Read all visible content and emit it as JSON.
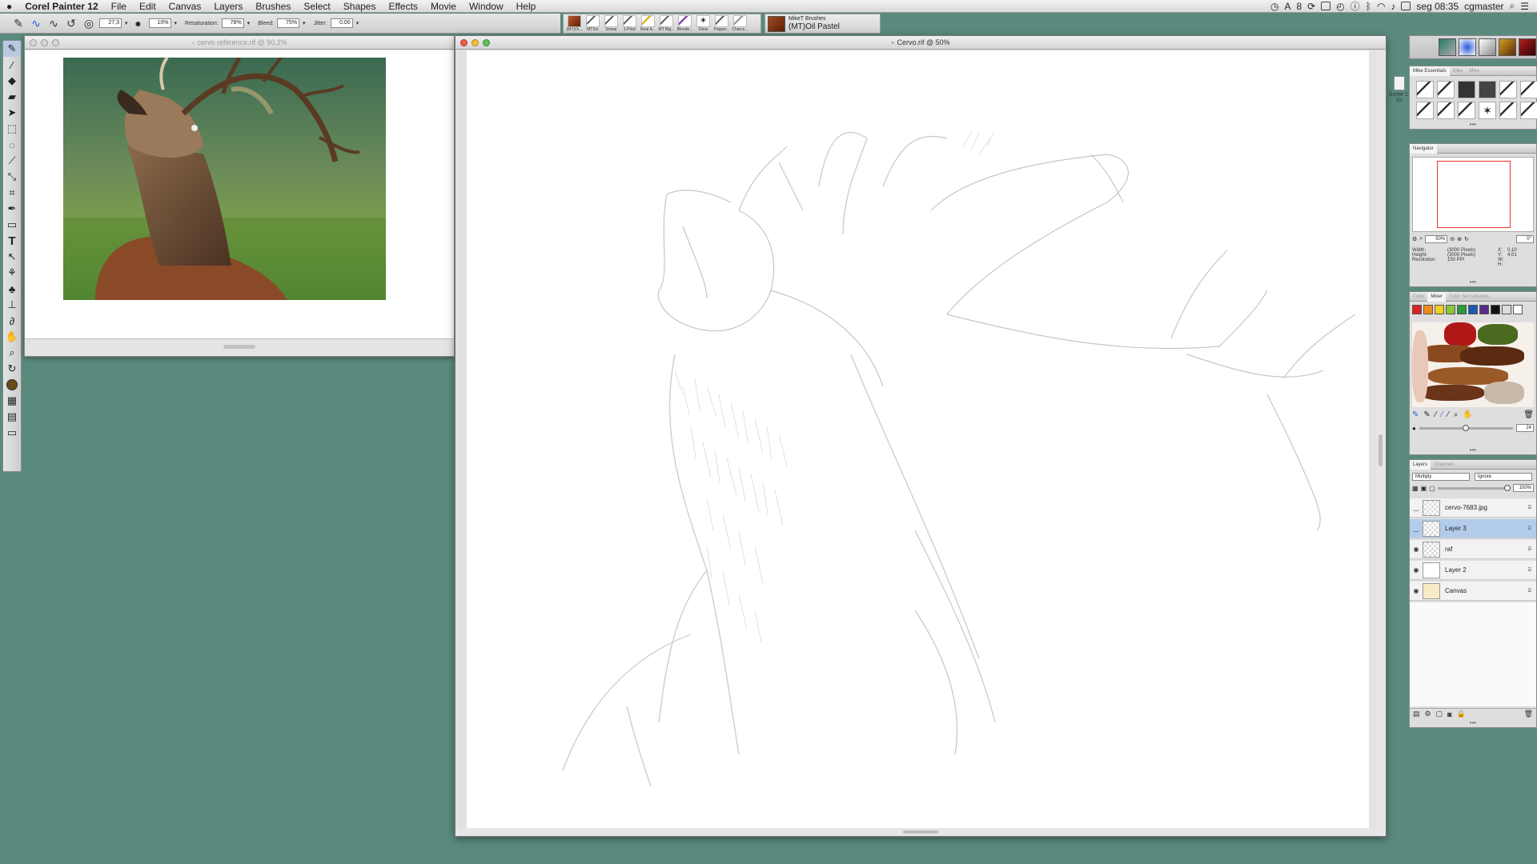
{
  "menubar": {
    "apple": "",
    "app_name": "Corel Painter 12",
    "items": [
      "File",
      "Edit",
      "Canvas",
      "Layers",
      "Brushes",
      "Select",
      "Shapes",
      "Effects",
      "Movie",
      "Window",
      "Help"
    ],
    "status_8": "8",
    "clock": "seg 08:35",
    "user": "cgmaster"
  },
  "property_bar": {
    "size_value": "27,3",
    "opacity_value": "10%",
    "resaturation_label": "Resaturation:",
    "resaturation_value": "78%",
    "bleed_label": "Bleed:",
    "bleed_value": "75%",
    "jitter_label": "Jitter:",
    "jitter_value": "0.00"
  },
  "brush_strip": [
    {
      "label": "(MT)Oi..."
    },
    {
      "label": "MTScr"
    },
    {
      "label": "Smear"
    },
    {
      "label": "1-Pixel"
    },
    {
      "label": "Real A..."
    },
    {
      "label": "MT Big..."
    },
    {
      "label": "Blende..."
    },
    {
      "label": "Glow"
    },
    {
      "label": "Pepper..."
    },
    {
      "label": "Charco..."
    }
  ],
  "current_brush": {
    "category": "MikeT Brushes",
    "variant": "(MT)Oil Pastel"
  },
  "ref_window": {
    "title": "cervo reference.rif @ 90,2%"
  },
  "main_window": {
    "title": "Cervo.rif @ 50%"
  },
  "screen_label": "Scree 1-10-",
  "brush_panel": {
    "tabs": [
      "Mike Essentials",
      "Mike",
      "Mike"
    ]
  },
  "navigator": {
    "tab": "Navigator",
    "zoom": "50%",
    "rotation": "0°",
    "width_label": "Width:",
    "width_value": "(3000 Pixels)",
    "height_label": "Height:",
    "height_value": "(3000 Pixels)",
    "res_label": "Resolution:",
    "res_value": "150 PPI",
    "x_label": "X:",
    "x_value": "0,10",
    "y_label": "Y:",
    "y_value": "4,01",
    "w_label": "W:",
    "h_label": "H:"
  },
  "color_panel": {
    "tabs": [
      "Color",
      "Mixer",
      "Color Set Libraries"
    ],
    "mixer_swatches": [
      "#e02020",
      "#f08a1a",
      "#f0d020",
      "#8ac43a",
      "#2a9a3a",
      "#1a5ab0",
      "#5a2a8a",
      "#111111",
      "#dddddd",
      "#ffffff"
    ],
    "brush_size": "24"
  },
  "layers_panel": {
    "tabs": [
      "Layers",
      "Channels"
    ],
    "composite_method": "Multiply",
    "preserve": "Ignore",
    "opacity": "100%",
    "layers": [
      {
        "name": "cervo-7683.jpg",
        "visible": false,
        "selected": false
      },
      {
        "name": "Layer 3",
        "visible": false,
        "selected": true
      },
      {
        "name": "raf",
        "visible": true,
        "selected": false
      },
      {
        "name": "Layer 2",
        "visible": true,
        "selected": false
      },
      {
        "name": "Canvas",
        "visible": true,
        "selected": false
      }
    ]
  },
  "colors": {
    "desktop": "#5a8a7e",
    "selection": "#b3ccec",
    "foreground": "#6b4a1c"
  }
}
